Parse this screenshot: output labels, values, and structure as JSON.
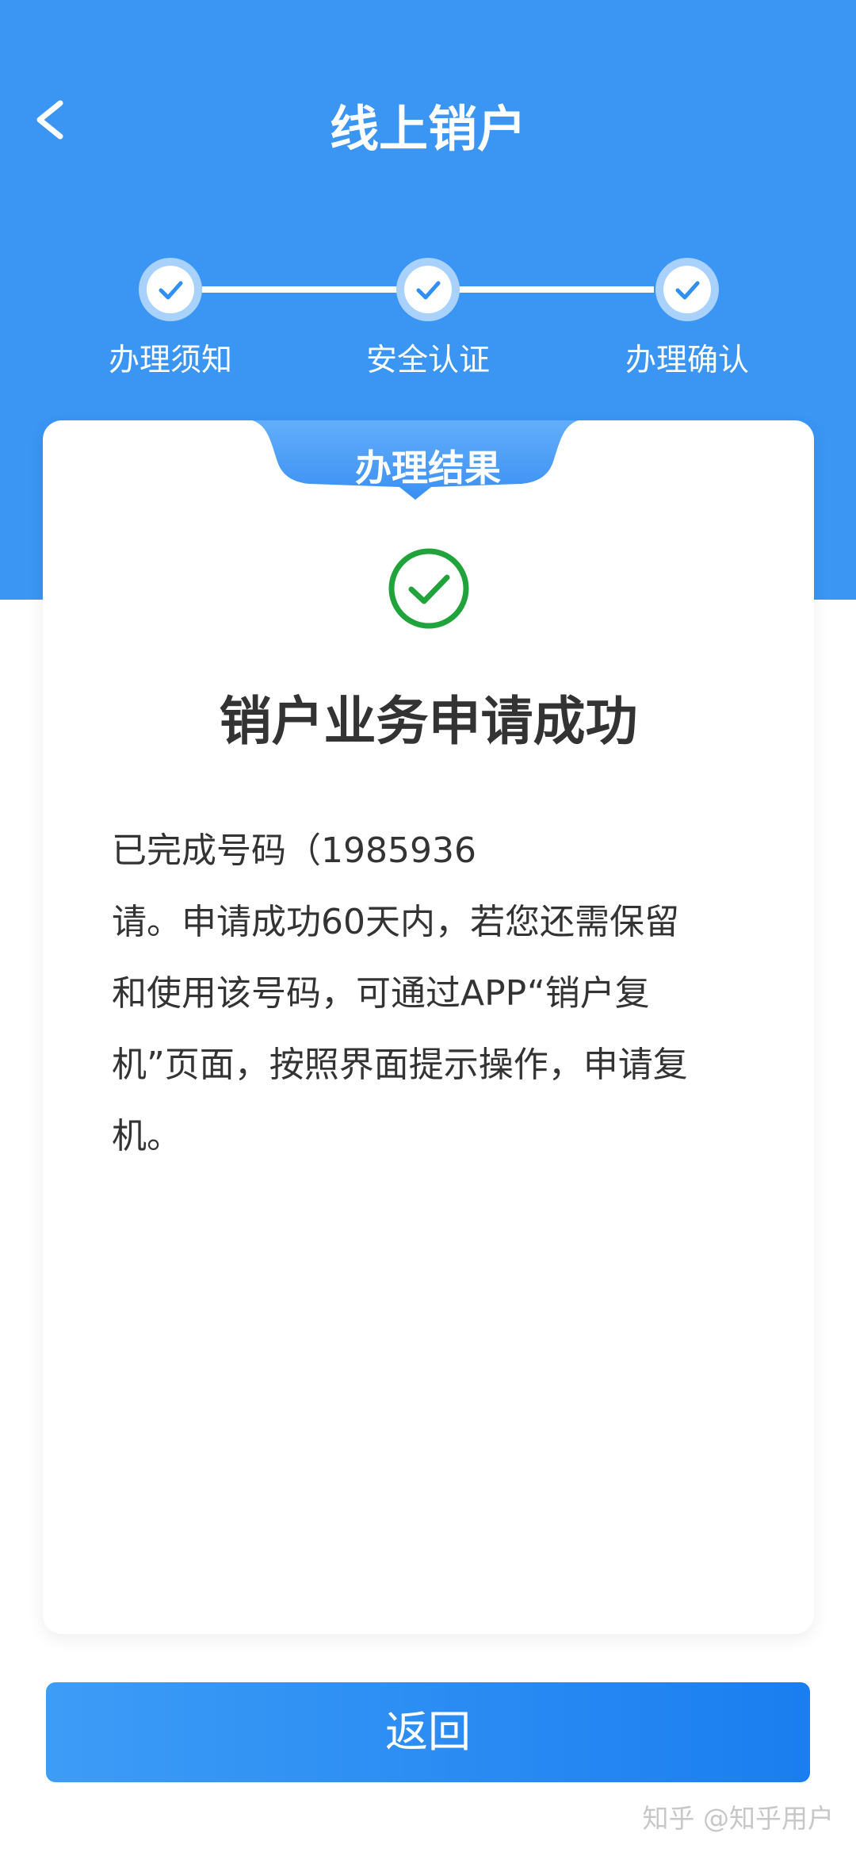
{
  "header": {
    "title": "线上销户",
    "back_icon": "chevron-left-icon",
    "background_color": "#3a95f3"
  },
  "steps": [
    {
      "label": "办理须知",
      "status": "done",
      "icon": "check-icon"
    },
    {
      "label": "安全认证",
      "status": "done",
      "icon": "check-icon"
    },
    {
      "label": "办理确认",
      "status": "done",
      "icon": "check-icon"
    }
  ],
  "result_card": {
    "tab_label": "办理结果",
    "status_icon": "success-check-circle-icon",
    "status_color": "#1fa33a",
    "title": "销户业务申请成功",
    "body_lines": [
      "已完成号码（1985936",
      "请。申请成功60天内，若您还需保留",
      "和使用该号码，可通过APP“销户复",
      "机”页面，按照界面提示操作，申请复",
      "机。"
    ]
  },
  "footer": {
    "return_label": "返回"
  },
  "watermark": "知乎 @知乎用户"
}
